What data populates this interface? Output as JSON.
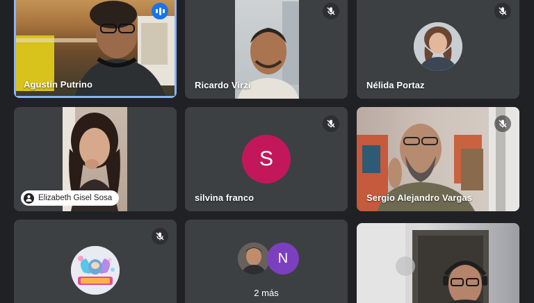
{
  "participants": {
    "agustin": {
      "name": "Agustín Putrino",
      "speaking_icon": "audio-level-icon"
    },
    "ricardo": {
      "name": "Ricardo Virzi",
      "mic_icon": "mic-off-icon"
    },
    "nelida": {
      "name": "Nélida Portaz",
      "mic_icon": "mic-off-icon"
    },
    "elizabeth": {
      "name": "Elizabeth Gisel Sosa",
      "chip_icon": "person-pin-icon"
    },
    "silvina": {
      "name": "silvina franco",
      "initial": "S",
      "avatar_color": "#c2185b",
      "mic_icon": "mic-off-icon"
    },
    "sergio": {
      "name": "Sergio Alejandro Vargas",
      "mic_icon": "mic-off-icon"
    },
    "mama": {
      "mic_icon": "mic-off-icon"
    },
    "overflow": {
      "initial": "N",
      "avatar_color": "#7b3fbf",
      "label": "2 más"
    },
    "bottom_right": {}
  },
  "colors": {
    "background": "#202124",
    "tile": "#3c4043",
    "active_border": "#8ab4f8",
    "speaking_badge": "#1a73e8"
  }
}
